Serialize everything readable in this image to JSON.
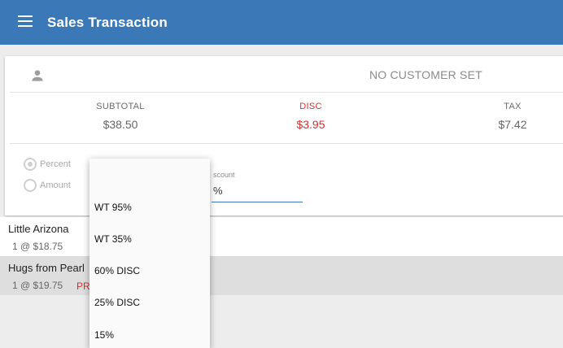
{
  "appbar": {
    "title": "Sales Transaction"
  },
  "customer": {
    "status": "NO CUSTOMER SET"
  },
  "totals": {
    "subtotal_label": "SUBTOTAL",
    "subtotal_value": "$38.50",
    "disc_label": "DISC",
    "disc_value": "$3.95",
    "tax_label": "TAX",
    "tax_value": "$7.42"
  },
  "discount_form": {
    "percent_label": "Percent",
    "amount_label": "Amount",
    "field_caption": "scount",
    "field_value": "%"
  },
  "items": [
    {
      "name": "Little Arizona",
      "qty_price": "1 @ $18.75",
      "tag": ""
    },
    {
      "name": "Hugs from Pearl",
      "qty_price": "1 @ $19.75",
      "tag": "PR"
    }
  ],
  "dropdown": {
    "options": [
      "WT 95%",
      "WT 35%",
      "60% DISC",
      "25% DISC",
      "15%"
    ]
  },
  "colors": {
    "appbar": "#3a78b8",
    "discount": "#d32f2f",
    "selected_row": "#dedede"
  }
}
